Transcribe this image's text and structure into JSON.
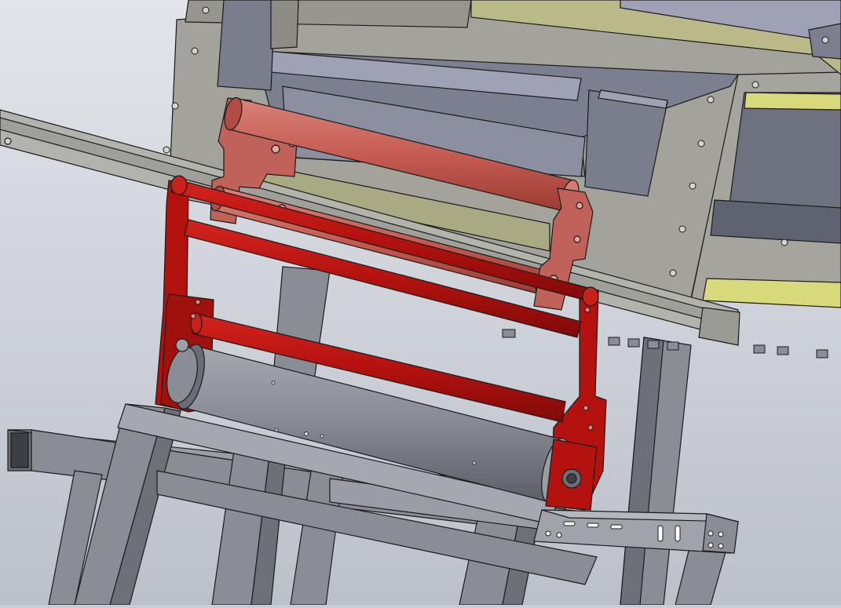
{
  "viewport": {
    "kind": "cad-assembly-view",
    "caption": ""
  },
  "colors": {
    "background_top": "#dfe2e8",
    "background_bottom": "#bfc3cc",
    "frame_steel": "#8a8d93",
    "frame_steel_dark": "#6d7077",
    "panel_grey": "#a3a39b",
    "panel_grey_dark": "#8d8d86",
    "blue_grey_part": "#7b7f8f",
    "blue_grey_light": "#9ea2b4",
    "olive_plate": "#b9b98a",
    "yellow_plate": "#d8d97a",
    "red_frame": "#b3120f",
    "red_frame_dark": "#7f0a08",
    "salmon_roller": "#c55c52",
    "salmon_roller_dark": "#a8443c",
    "drum_grey": "#8b8d96",
    "drum_grey_dark": "#6b6d74",
    "edge": "#1b1b1b"
  },
  "parts": [
    {
      "name": "background-structure-frame"
    },
    {
      "name": "upper-housing-panel"
    },
    {
      "name": "upper-tension-roller"
    },
    {
      "name": "lower-tension-roller"
    },
    {
      "name": "red-swing-frame"
    },
    {
      "name": "red-cross-bar"
    },
    {
      "name": "main-drum-roller"
    },
    {
      "name": "support-stand"
    },
    {
      "name": "slotted-mount-plate"
    }
  ]
}
